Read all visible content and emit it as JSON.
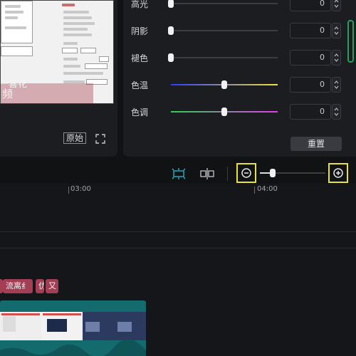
{
  "preview": {
    "caption_line1": "一喜花",
    "caption_line2": "频",
    "original_label": "原始",
    "fullscreen_icon": "fullscreen-icon"
  },
  "adjust": {
    "rows": [
      {
        "label": "高光",
        "value": "0",
        "level": 0.0
      },
      {
        "label": "阴影",
        "value": "0",
        "level": 0.0
      },
      {
        "label": "褪色",
        "value": "0",
        "level": 0.0
      },
      {
        "label": "色温",
        "value": "0",
        "level": 0.5,
        "gradient": [
          "#2c3cff",
          "#f3e23a"
        ]
      },
      {
        "label": "色调",
        "value": "0",
        "level": 0.5,
        "gradient": [
          "#2fd14a",
          "#e23cf0"
        ]
      }
    ],
    "reset_label": "重置"
  },
  "toolbar": {
    "icons": [
      "split-icon",
      "freeze-icon",
      "zoom-out-icon",
      "zoom-in-icon"
    ],
    "zoom_level": 0.2
  },
  "timeline": {
    "ticks": [
      "03:00",
      "04:00"
    ],
    "subtitle_clips": [
      "流离纟",
      "仂",
      "又"
    ],
    "accent": "#e8e33a"
  }
}
